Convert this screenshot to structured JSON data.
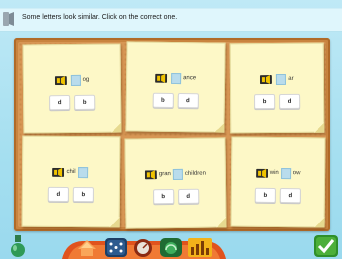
{
  "header": {
    "instruction": "Some letters look similar. Click on the correct one."
  },
  "cards": [
    {
      "prefix": "",
      "suffix": "og",
      "options": [
        "d",
        "b"
      ]
    },
    {
      "prefix": "",
      "suffix": "ance",
      "options": [
        "b",
        "d"
      ]
    },
    {
      "prefix": "",
      "suffix": "ar",
      "options": [
        "b",
        "d"
      ]
    },
    {
      "prefix": "chil",
      "suffix": "",
      "options": [
        "d",
        "b"
      ]
    },
    {
      "prefix": "gran",
      "suffix": "children",
      "options": [
        "b",
        "d"
      ]
    },
    {
      "prefix": "win",
      "suffix": "ow",
      "options": [
        "b",
        "d"
      ]
    }
  ],
  "icons": {
    "speaker": "speaker-icon",
    "word_audio": "play-audio-icon",
    "toolbar": [
      "bottle-icon",
      "home-icon",
      "dice-icon",
      "meter-icon",
      "dashboard-icon",
      "chart-icon",
      "check-icon"
    ]
  },
  "colors": {
    "background": "#a5dff0",
    "card": "#fdf8c7",
    "board": "#d79654",
    "blank": "#b9dcec",
    "check": "#4caf3a"
  }
}
